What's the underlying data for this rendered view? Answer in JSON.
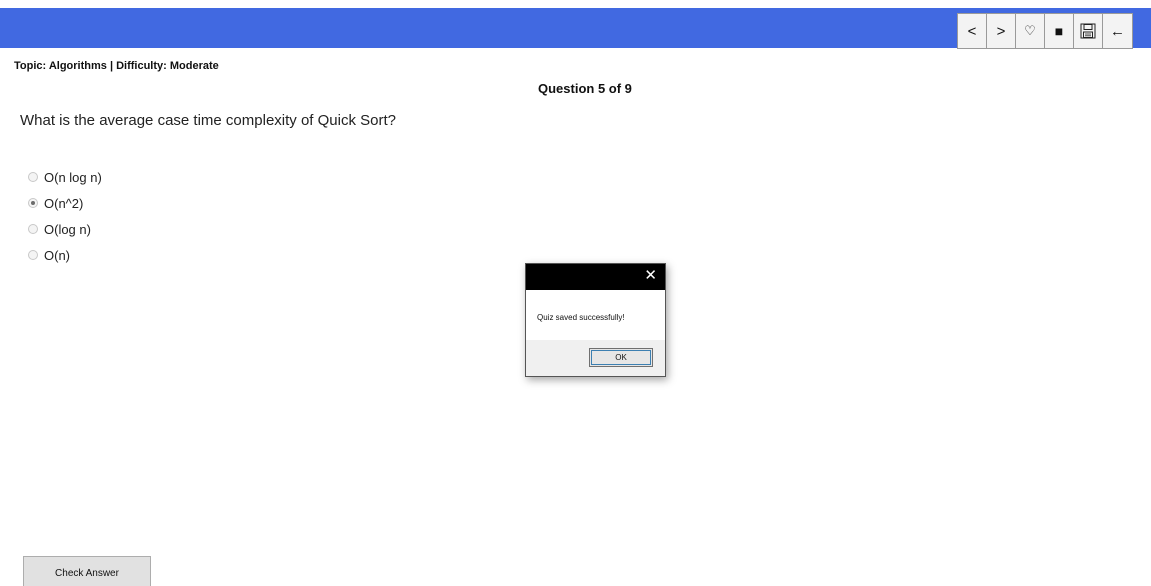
{
  "header": {
    "accent_color": "#4169e1",
    "toolbar": [
      {
        "name": "previous-button",
        "icon": "chevron-left-icon",
        "label": "<"
      },
      {
        "name": "next-button",
        "icon": "chevron-right-icon",
        "label": ">"
      },
      {
        "name": "favorite-button",
        "icon": "heart-icon",
        "label": "♡"
      },
      {
        "name": "stop-button",
        "icon": "stop-icon",
        "label": "■"
      },
      {
        "name": "save-button",
        "icon": "save-icon",
        "label": ""
      },
      {
        "name": "back-button",
        "icon": "arrow-left-icon",
        "label": "←"
      }
    ]
  },
  "quiz": {
    "topic_line": "Topic: Algorithms | Difficulty: Moderate",
    "question_counter": "Question 5 of 9",
    "question_text": "What is the average case time complexity of Quick Sort?",
    "options": [
      {
        "label": "O(n log n)",
        "selected": false
      },
      {
        "label": "O(n^2)",
        "selected": true
      },
      {
        "label": "O(log n)",
        "selected": false
      },
      {
        "label": "O(n)",
        "selected": false
      }
    ],
    "check_answer_label": "Check Answer"
  },
  "dialog": {
    "close_glyph": "✕",
    "message": "Quiz saved successfully!",
    "ok_label": "OK"
  }
}
